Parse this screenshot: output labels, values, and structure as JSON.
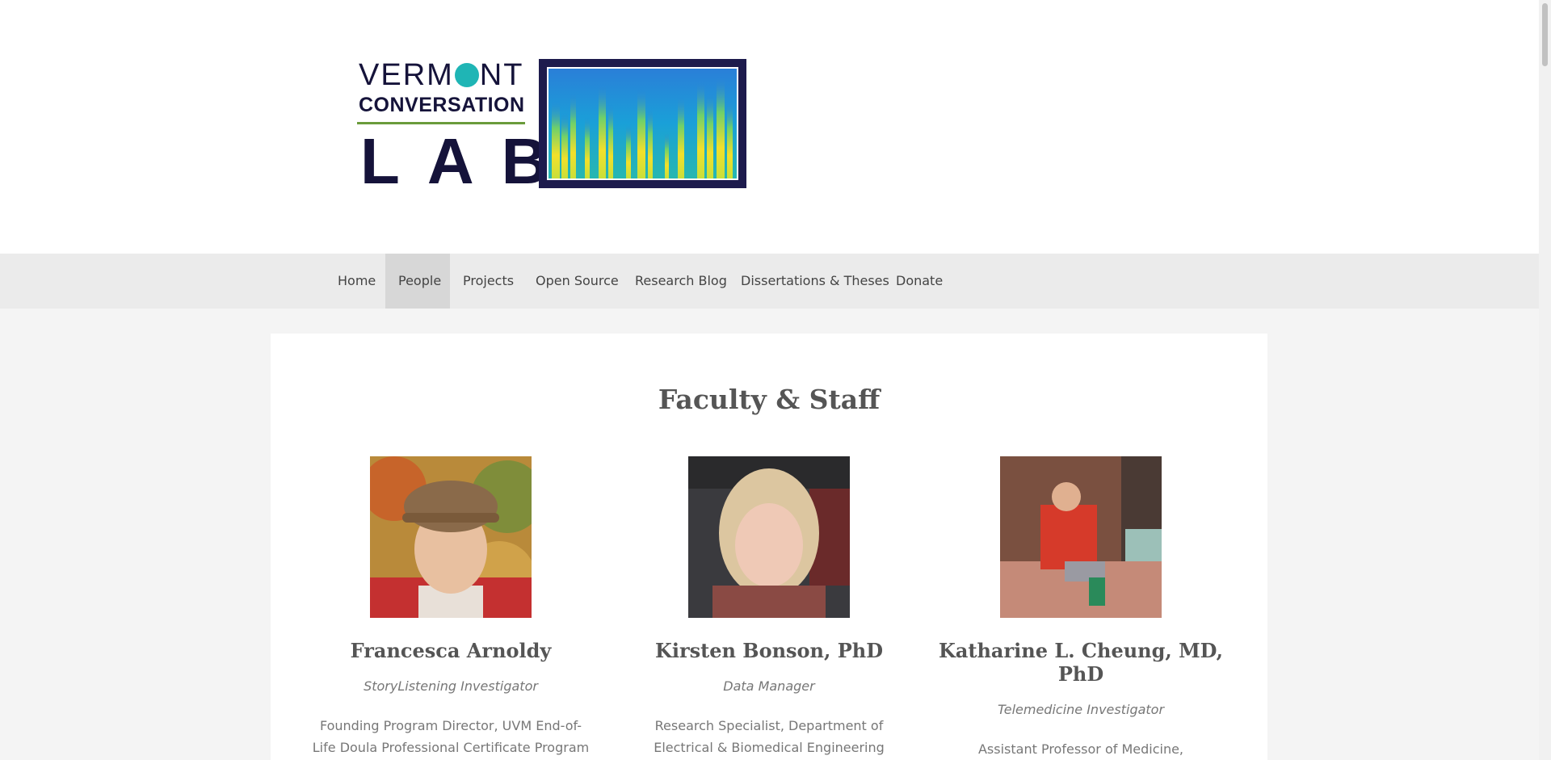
{
  "logo": {
    "line1_a": "VERM",
    "line1_b": "NT",
    "line2": "CONVERSATION",
    "line3": "LAB"
  },
  "nav": {
    "items": [
      {
        "label": "Home"
      },
      {
        "label": "People",
        "active": true
      },
      {
        "label": "Projects"
      },
      {
        "label": "Open Source"
      },
      {
        "label": "Research Blog"
      },
      {
        "label": "Dissertations & Theses"
      },
      {
        "label": "Donate"
      }
    ]
  },
  "main": {
    "title": "Faculty & Staff",
    "people": [
      {
        "name": "Francesca Arnoldy",
        "role": "StoryListening Investigator",
        "desc": "Founding Program Director, UVM End-of-Life Doula Professional Certificate Program"
      },
      {
        "name": "Kirsten Bonson, PhD",
        "role": "Data Manager",
        "desc": "Research Specialist, Department of Electrical & Biomedical Engineering"
      },
      {
        "name": "Katharine L. Cheung, MD, PhD",
        "role": "Telemedicine Investigator",
        "desc": "Assistant Professor of Medicine, Nephrology ; Center of Aging"
      }
    ]
  },
  "colors": {
    "accent_teal": "#1fb5b5",
    "logo_navy": "#15133a",
    "nav_bg": "#ebebeb",
    "nav_active": "#d7d7d7"
  }
}
